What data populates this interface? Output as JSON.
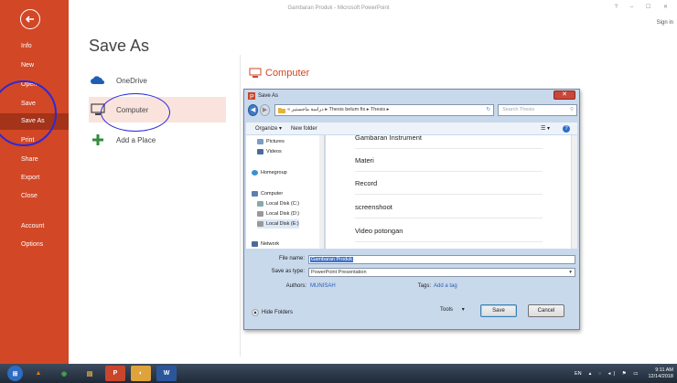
{
  "window": {
    "title": "Gambaran Produk - Microsoft PowerPoint",
    "controls": "? – ☐ ✕",
    "signin": "Sign in"
  },
  "nav": {
    "items": [
      {
        "label": "Info",
        "active": false
      },
      {
        "label": "New",
        "active": false
      },
      {
        "label": "Open",
        "active": false
      },
      {
        "label": "Save",
        "active": false
      },
      {
        "label": "Save As",
        "active": true
      },
      {
        "label": "Print",
        "active": false
      },
      {
        "label": "Share",
        "active": false
      },
      {
        "label": "Export",
        "active": false
      },
      {
        "label": "Close",
        "active": false
      },
      {
        "label": "Account",
        "active": false
      },
      {
        "label": "Options",
        "active": false
      }
    ]
  },
  "saveas": {
    "title": "Save As",
    "places": [
      {
        "label": "OneDrive",
        "icon": "cloud-icon"
      },
      {
        "label": "Computer",
        "icon": "computer-icon",
        "selected": true
      },
      {
        "label": "Add a Place",
        "icon": "plus-icon"
      }
    ],
    "right_header": "Computer"
  },
  "dialog": {
    "title": "Save As",
    "address": "« دراسة ماجستير ▸ Thesis belum fix ▸ Thesis ▸",
    "search_placeholder": "Search Thesis",
    "toolbar": {
      "organize": "Organize ▾",
      "new_folder": "New folder"
    },
    "tree": [
      {
        "label": "Pictures",
        "color": "#7a9cc6"
      },
      {
        "label": "Videos",
        "color": "#4a6b9a"
      },
      {
        "label": "Homegroup",
        "color": "#3b8fd3"
      },
      {
        "label": "Computer",
        "color": "#5b7fb0"
      },
      {
        "label": "Local Disk (C:)",
        "color": "#8aa"
      },
      {
        "label": "Local Disk (D:)",
        "color": "#999"
      },
      {
        "label": "Local Disk (E:)",
        "color": "#999"
      },
      {
        "label": "Network",
        "color": "#4a6b9a"
      }
    ],
    "files": [
      "Gambaran Instrument",
      "Materi",
      "Record",
      "screenshoot",
      "Video potongan"
    ],
    "file_name_label": "File name:",
    "file_name_value": "Gambaran Produk",
    "save_type_label": "Save as type:",
    "save_type_value": "PowerPoint Presentation",
    "authors_label": "Authors:",
    "authors_value": "MUNISAH",
    "tags_label": "Tags:",
    "tags_value": "Add a tag",
    "hide_folders": "Hide Folders",
    "tools": "Tools",
    "save": "Save",
    "cancel": "Cancel"
  },
  "taskbar": {
    "apps": [
      {
        "name": "start-orb",
        "color": "#2d6cc0",
        "glyph": "⊞"
      },
      {
        "name": "vlc",
        "color": "#e8760f",
        "glyph": "▲"
      },
      {
        "name": "chrome",
        "color": "#3a8e3a",
        "glyph": "◉"
      },
      {
        "name": "explorer",
        "color": "#d9a531",
        "glyph": "▤"
      },
      {
        "name": "powerpoint",
        "color": "#c9462c",
        "glyph": "P"
      },
      {
        "name": "paint",
        "color": "#e0a23a",
        "glyph": "◐"
      },
      {
        "name": "word",
        "color": "#2b579a",
        "glyph": "W"
      }
    ],
    "lang": "EN",
    "time": "9:11 AM",
    "date": "12/14/2018"
  }
}
